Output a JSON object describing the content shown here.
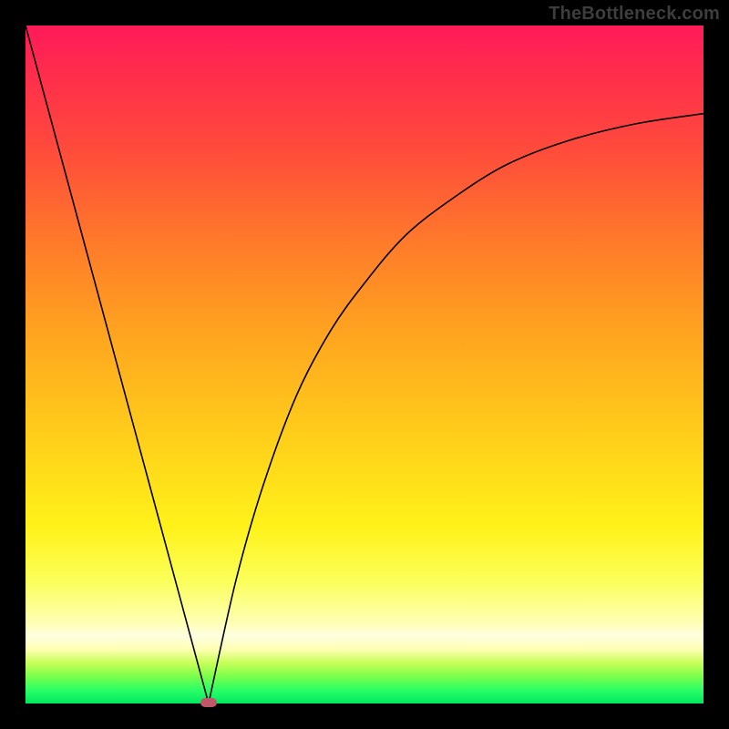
{
  "watermark": {
    "text": "TheBottleneck.com"
  },
  "chart_data": {
    "type": "line",
    "title": "",
    "xlabel": "",
    "ylabel": "",
    "xlim": [
      0,
      1
    ],
    "ylim": [
      0,
      1
    ],
    "grid": false,
    "legend": false,
    "anchor": {
      "x": 0.27,
      "y": 0.0,
      "note": "minimum point; small red marker"
    },
    "series": [
      {
        "name": "left-branch",
        "note": "steep nearly-straight descent from top-left to minimum",
        "x": [
          0.0,
          0.054,
          0.108,
          0.162,
          0.216,
          0.27
        ],
        "y": [
          1.0,
          0.8,
          0.6,
          0.4,
          0.2,
          0.0
        ]
      },
      {
        "name": "right-branch",
        "note": "rise from minimum, concave, asymptoting toward ~0.87",
        "x": [
          0.27,
          0.31,
          0.35,
          0.4,
          0.45,
          0.5,
          0.56,
          0.63,
          0.71,
          0.8,
          0.9,
          1.0
        ],
        "y": [
          0.0,
          0.18,
          0.32,
          0.455,
          0.55,
          0.62,
          0.69,
          0.745,
          0.795,
          0.83,
          0.855,
          0.87
        ]
      }
    ],
    "background_gradient_stops": [
      {
        "pos": 0.0,
        "color": "#ff1a5a"
      },
      {
        "pos": 0.32,
        "color": "#ff7a2a"
      },
      {
        "pos": 0.62,
        "color": "#ffd21a"
      },
      {
        "pos": 0.88,
        "color": "#feffb3"
      },
      {
        "pos": 1.0,
        "color": "#00e860"
      }
    ]
  }
}
